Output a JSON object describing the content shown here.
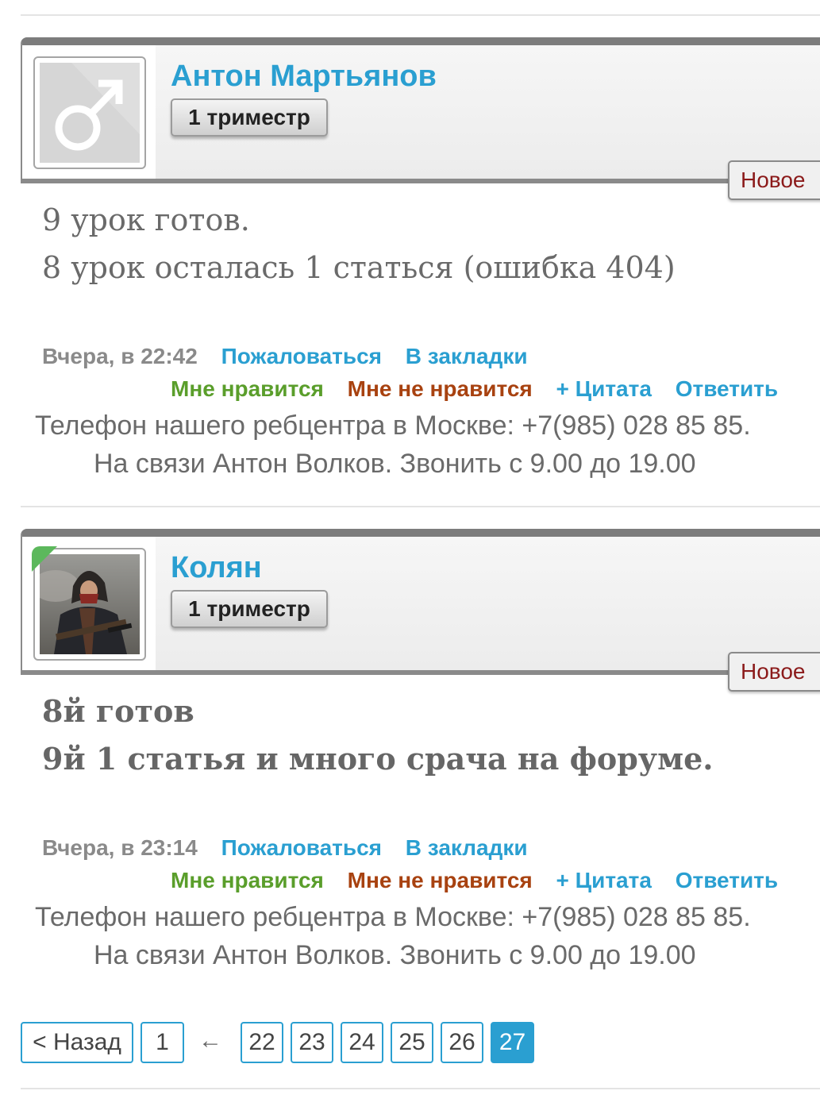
{
  "posts": [
    {
      "author": "Антон Мартьянов",
      "rank": "1 триместр",
      "new_label": "Новое",
      "avatar": "male-symbol-icon",
      "message_lines": [
        "9 урок готов.",
        "8 урок осталась 1 статься (ошибка 404)"
      ],
      "date": "Вчера, в 22:42",
      "report": "Пожаловаться",
      "bookmark": "В закладки",
      "like": "Мне нравится",
      "dislike": "Мне не нравится",
      "quote": "+ Цитата",
      "reply": "Ответить",
      "signature": [
        "Телефон нашего ребцентра в Москве: +7(985) 028 85 85.",
        "На связи Антон Волков. Звонить с 9.00 до 19.00"
      ]
    },
    {
      "author": "Колян",
      "rank": "1 триместр",
      "new_label": "Новое",
      "avatar": "user-photo",
      "online_color": "#5cb85c",
      "message_lines": [
        "8й готов",
        "9й 1 статья и много срача на форуме."
      ],
      "date": "Вчера, в 23:14",
      "report": "Пожаловаться",
      "bookmark": "В закладки",
      "like": "Мне нравится",
      "dislike": "Мне не нравится",
      "quote": "+ Цитата",
      "reply": "Ответить",
      "signature": [
        "Телефон нашего ребцентра в Москве: +7(985) 028 85 85.",
        "На связи Антон Волков. Звонить с 9.00 до 19.00"
      ]
    }
  ],
  "pagination": {
    "back": "< Назад",
    "first": "1",
    "arrow": "←",
    "pages": [
      "22",
      "23",
      "24",
      "25",
      "26",
      "27"
    ],
    "active": "27"
  },
  "colors": {
    "link": "#2a9fd1",
    "like": "#5a9e2b",
    "dislike": "#a84210",
    "new": "#8b1a1a"
  }
}
